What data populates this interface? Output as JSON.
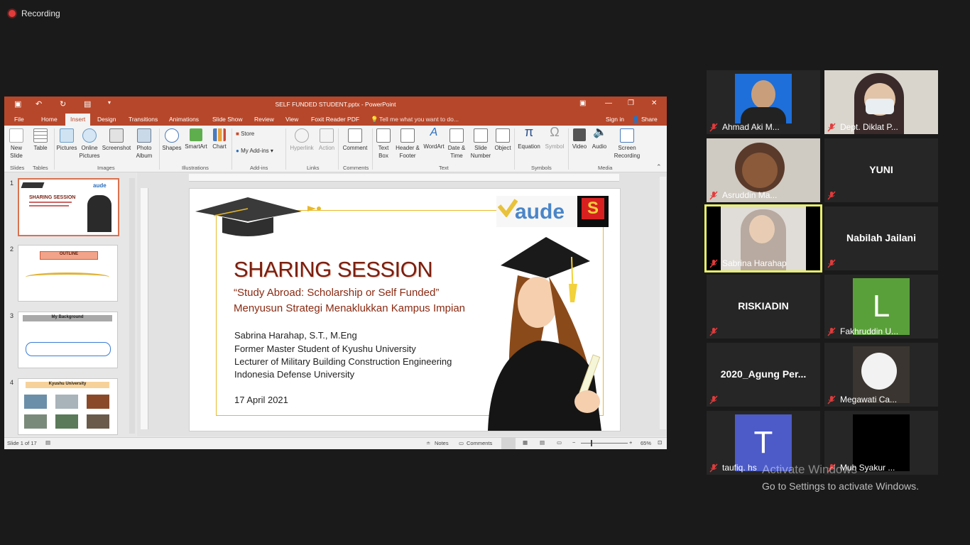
{
  "recording": {
    "label": "Recording"
  },
  "ppt": {
    "window_title": "SELF FUNDED STUDENT.pptx - PowerPoint",
    "menu": [
      "File",
      "Home",
      "Insert",
      "Design",
      "Transitions",
      "Animations",
      "Slide Show",
      "Review",
      "View",
      "Foxit Reader PDF"
    ],
    "tell_me": "Tell me what you want to do...",
    "sign_in": "Sign in",
    "share": "Share",
    "ribbon": {
      "new_slide": "New Slide",
      "table": "Table",
      "pictures": "Pictures",
      "online_pictures": "Online Pictures",
      "screenshot": "Screenshot",
      "photo_album": "Photo Album",
      "shapes": "Shapes",
      "smartart": "SmartArt",
      "chart": "Chart",
      "store": "Store",
      "my_addins": "My Add-ins",
      "hyperlink": "Hyperlink",
      "action": "Action",
      "comment": "Comment",
      "text_box": "Text Box",
      "header_footer": "Header & Footer",
      "wordart": "WordArt",
      "date_time": "Date & Time",
      "slide_number": "Slide Number",
      "object": "Object",
      "equation": "Equation",
      "symbol": "Symbol",
      "video": "Video",
      "audio": "Audio",
      "screen_recording": "Screen Recording",
      "groups": [
        "Slides",
        "Tables",
        "Images",
        "Illustrations",
        "Add-ins",
        "Links",
        "Comments",
        "Text",
        "Symbols",
        "Media"
      ]
    },
    "thumbnails": [
      {
        "num": "1",
        "title": "SHARING SESSION"
      },
      {
        "num": "2",
        "title": "OUTLINE"
      },
      {
        "num": "3",
        "title": "My Background"
      },
      {
        "num": "4",
        "title": "Kyushu University"
      }
    ],
    "slide": {
      "logo_text": "aude",
      "title": "SHARING SESSION",
      "subtitle1": "“Study Abroad: Scholarship or Self Funded”",
      "subtitle2": "Menyusun Strategi Menaklukkan Kampus Impian",
      "presenter": "Sabrina Harahap, S.T., M.Eng",
      "line1": "Former Master Student of Kyushu University",
      "line2": "Lecturer of Military Building Construction Engineering",
      "line3": "Indonesia Defense University",
      "date": "17 April 2021"
    },
    "status": {
      "slide_of": "Slide 1 of 17",
      "notes": "Notes",
      "comments": "Comments",
      "zoom": "65%"
    },
    "colors": {
      "accent": "#b7472a"
    }
  },
  "participants": [
    {
      "name": "Ahmad Aki M...",
      "type": "video"
    },
    {
      "name": "Dept. Diklat P...",
      "type": "video"
    },
    {
      "name": "Asruddin Ma...",
      "type": "video"
    },
    {
      "name": "YUNI",
      "type": "name"
    },
    {
      "name": "Sabrina Harahap",
      "type": "video",
      "active": true
    },
    {
      "name": "Nabilah Jailani",
      "type": "name"
    },
    {
      "name": "RISKIADIN",
      "type": "name"
    },
    {
      "name": "Fakhruddin U...",
      "type": "avatar",
      "letter": "L",
      "color": "#5aa03a"
    },
    {
      "name": "2020_Agung  Per...",
      "type": "name"
    },
    {
      "name": "Megawati Ca...",
      "type": "video"
    },
    {
      "name": "taufiq. hs",
      "type": "avatar",
      "letter": "T",
      "color": "#4c5bc7"
    },
    {
      "name": "Muh Syakur ...",
      "type": "video"
    }
  ],
  "watermark": {
    "line1": "Activate Windows",
    "line2": "Go to Settings to activate Windows."
  }
}
